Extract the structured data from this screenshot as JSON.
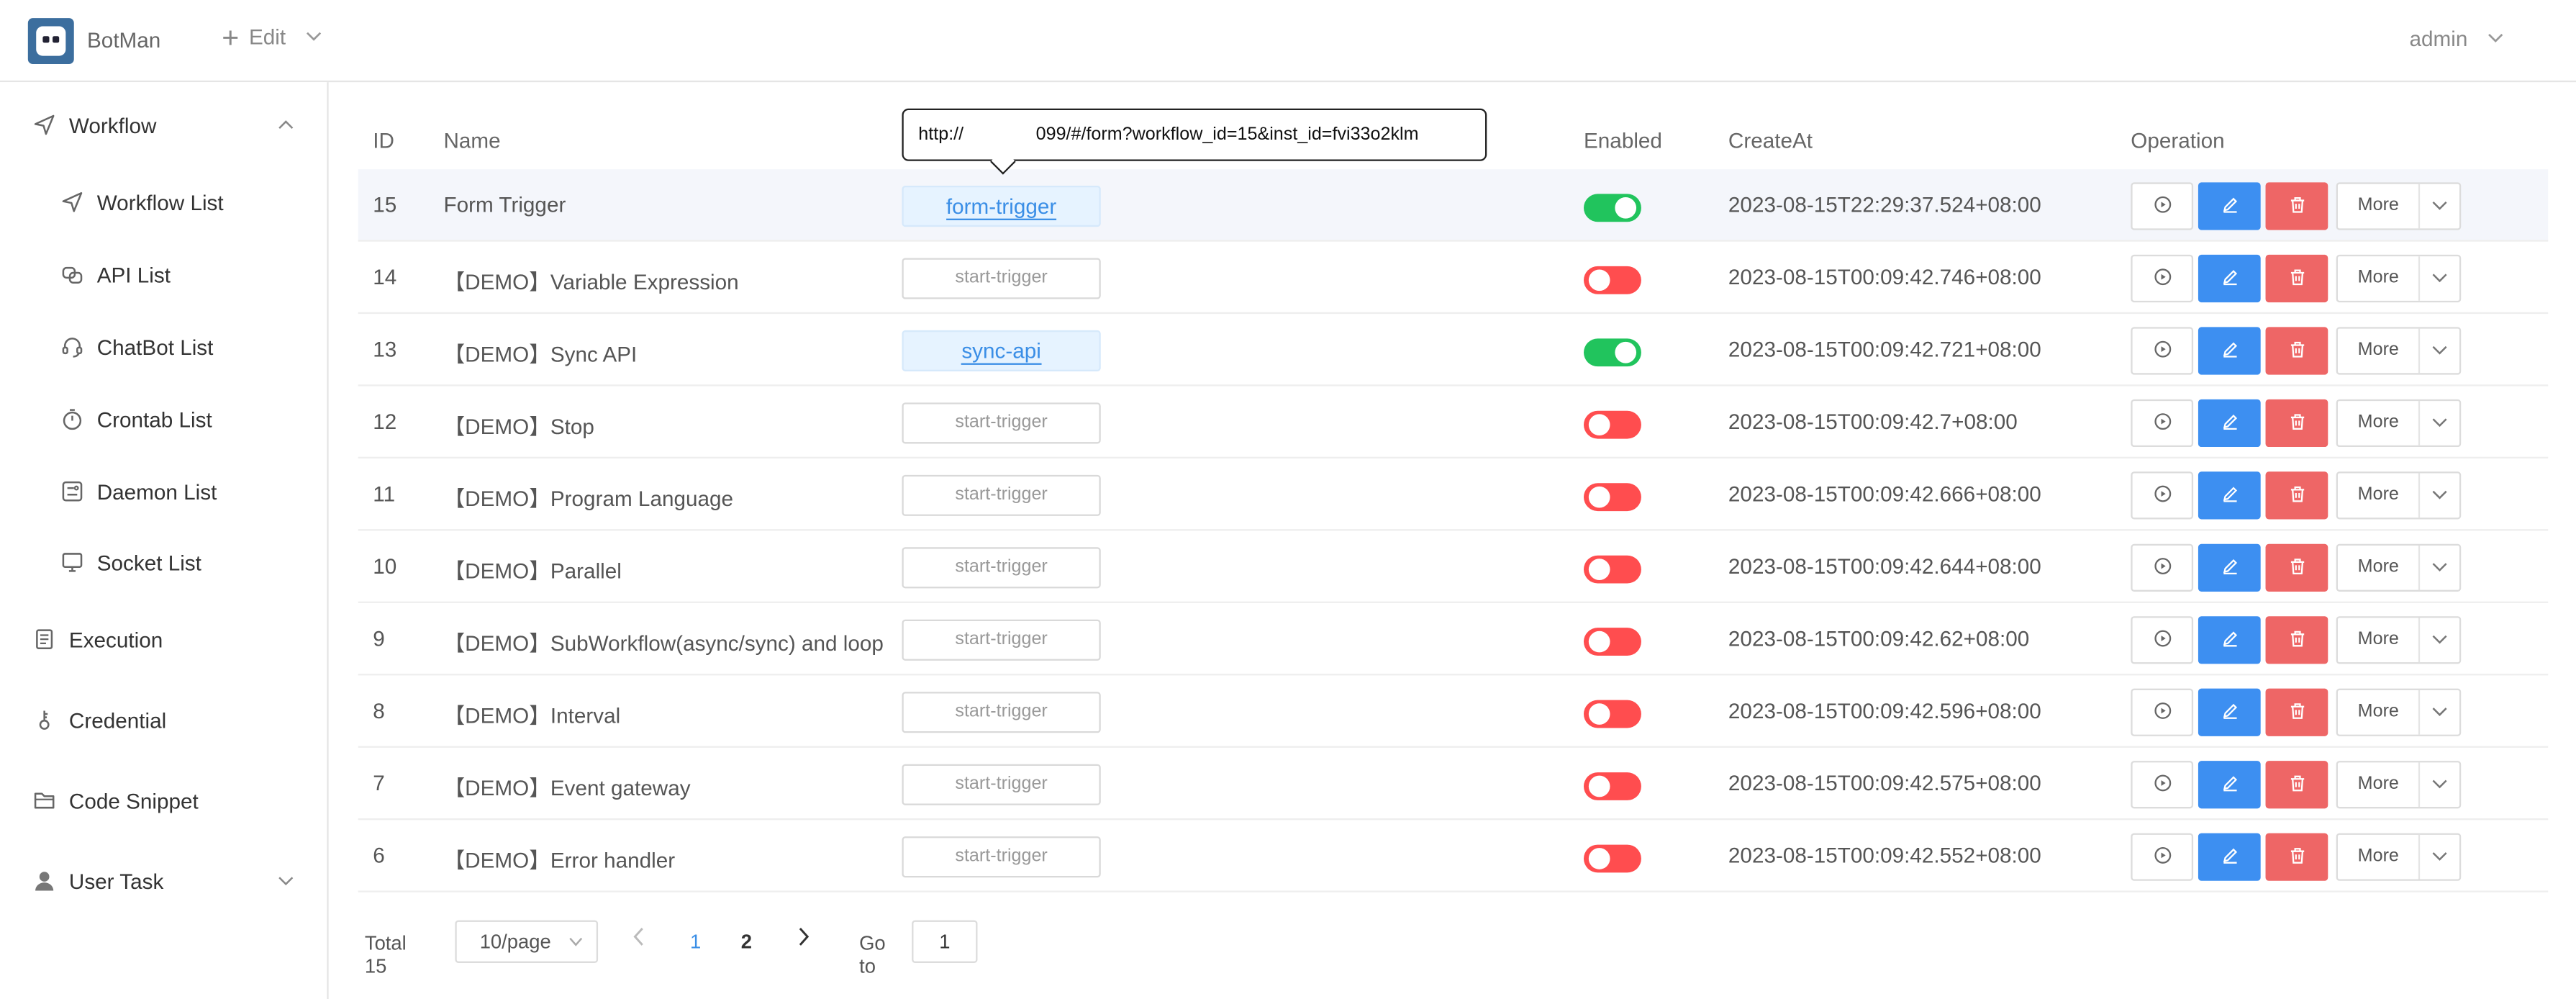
{
  "header": {
    "app_name": "BotMan",
    "edit_label": "Edit",
    "user_label": "admin"
  },
  "sidebar": {
    "items": [
      {
        "label": "Workflow",
        "icon": "send-icon",
        "expanded": true
      },
      {
        "label": "Workflow List",
        "icon": "send-icon"
      },
      {
        "label": "API List",
        "icon": "api-icon"
      },
      {
        "label": "ChatBot List",
        "icon": "headset-icon"
      },
      {
        "label": "Crontab List",
        "icon": "stopwatch-icon"
      },
      {
        "label": "Daemon List",
        "icon": "daemon-icon"
      },
      {
        "label": "Socket List",
        "icon": "monitor-icon"
      },
      {
        "label": "Execution",
        "icon": "document-icon"
      },
      {
        "label": "Credential",
        "icon": "key-icon"
      },
      {
        "label": "Code Snippet",
        "icon": "folder-icon"
      },
      {
        "label": "User Task",
        "icon": "user-icon",
        "expanded": false
      }
    ]
  },
  "table": {
    "headers": {
      "id": "ID",
      "name": "Name",
      "enabled": "Enabled",
      "create_at": "CreateAt",
      "operation": "Operation"
    },
    "more_label": "More",
    "rows": [
      {
        "id": "15",
        "name": "Form Trigger",
        "trigger": "form-trigger",
        "link": true,
        "enabled": true,
        "create_at": "2023-08-15T22:29:37.524+08:00"
      },
      {
        "id": "14",
        "name": "【DEMO】Variable Expression",
        "trigger": "start-trigger",
        "link": false,
        "enabled": false,
        "create_at": "2023-08-15T00:09:42.746+08:00"
      },
      {
        "id": "13",
        "name": "【DEMO】Sync API",
        "trigger": "sync-api",
        "link": true,
        "enabled": true,
        "create_at": "2023-08-15T00:09:42.721+08:00"
      },
      {
        "id": "12",
        "name": "【DEMO】Stop",
        "trigger": "start-trigger",
        "link": false,
        "enabled": false,
        "create_at": "2023-08-15T00:09:42.7+08:00"
      },
      {
        "id": "11",
        "name": "【DEMO】Program Language",
        "trigger": "start-trigger",
        "link": false,
        "enabled": false,
        "create_at": "2023-08-15T00:09:42.666+08:00"
      },
      {
        "id": "10",
        "name": "【DEMO】Parallel",
        "trigger": "start-trigger",
        "link": false,
        "enabled": false,
        "create_at": "2023-08-15T00:09:42.644+08:00"
      },
      {
        "id": "9",
        "name": "【DEMO】SubWorkflow(async/sync) and loop",
        "trigger": "start-trigger",
        "link": false,
        "enabled": false,
        "create_at": "2023-08-15T00:09:42.62+08:00"
      },
      {
        "id": "8",
        "name": "【DEMO】Interval",
        "trigger": "start-trigger",
        "link": false,
        "enabled": false,
        "create_at": "2023-08-15T00:09:42.596+08:00"
      },
      {
        "id": "7",
        "name": "【DEMO】Event gateway",
        "trigger": "start-trigger",
        "link": false,
        "enabled": false,
        "create_at": "2023-08-15T00:09:42.575+08:00"
      },
      {
        "id": "6",
        "name": "【DEMO】Error handler",
        "trigger": "start-trigger",
        "link": false,
        "enabled": false,
        "create_at": "2023-08-15T00:09:42.552+08:00"
      }
    ]
  },
  "tooltip": {
    "text_start": "http://",
    "text_end": "099/#/form?workflow_id=15&inst_id=fvi33o2klm"
  },
  "pagination": {
    "total": "Total 15",
    "page_size": "10/page",
    "pages": [
      "1",
      "2"
    ],
    "current_page": "1",
    "goto_label": "Go to",
    "goto_value": "1"
  },
  "colors": {
    "primary": "#3d8ff1",
    "danger": "#ee6666",
    "switch_on": "#21c45d",
    "switch_off": "#ff4d4f"
  }
}
